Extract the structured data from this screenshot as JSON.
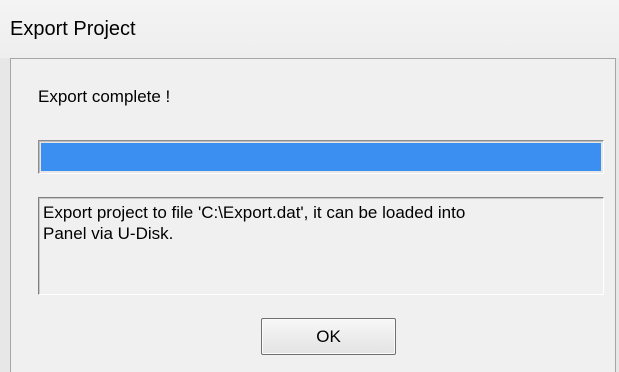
{
  "window": {
    "title": "Export Project"
  },
  "dialog": {
    "status_text": "Export complete !",
    "progress_percent": 100,
    "progress_color": "#3a8ff0",
    "message": "Export project to file 'C:\\Export.dat', it can be loaded into\nPanel via U-Disk.",
    "ok_label": "OK"
  }
}
